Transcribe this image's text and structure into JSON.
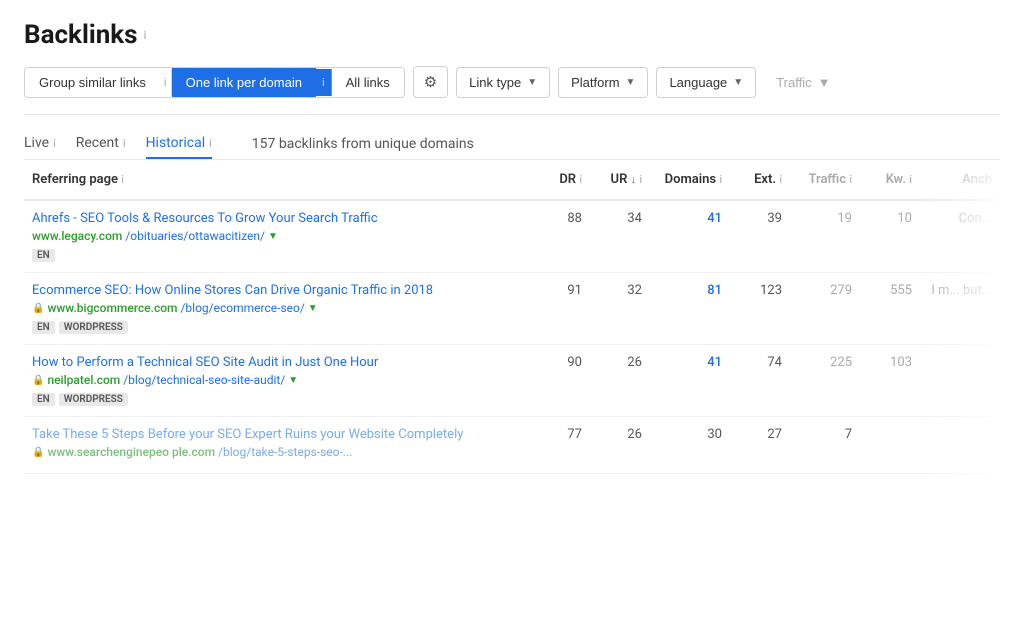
{
  "page": {
    "title": "Backlinks",
    "title_info": "i"
  },
  "toolbar": {
    "group_similar": "Group similar links",
    "group_similar_info": "i",
    "one_per_domain": "One link per domain",
    "one_per_domain_info": "i",
    "all_links": "All links",
    "gear_icon": "⚙",
    "link_type": "Link type",
    "platform": "Platform",
    "language": "Language",
    "traffic": "Traffic"
  },
  "subtabs": {
    "live": "Live",
    "live_info": "i",
    "recent": "Recent",
    "recent_info": "i",
    "historical": "Historical",
    "historical_info": "i",
    "summary": "157 backlinks from unique domains"
  },
  "table": {
    "headers": {
      "referring_page": "Referring page",
      "referring_page_info": "i",
      "dr": "DR",
      "dr_info": "i",
      "ur": "UR",
      "ur_sort": "↓",
      "ur_info": "i",
      "domains": "Domains",
      "domains_info": "i",
      "ext": "Ext.",
      "ext_info": "i",
      "traffic": "Traffic",
      "traffic_info": "i",
      "kw": "Kw.",
      "kw_info": "i",
      "anch": "Anch"
    },
    "rows": [
      {
        "title": "Ahrefs - SEO Tools & Resources To Grow Your Search Traffic",
        "domain": "www.legacy.com",
        "path": "/obituaries/ottawacitizen/",
        "has_dropdown": true,
        "has_lock": false,
        "badges": [
          "EN"
        ],
        "dr": 88,
        "ur": 34,
        "domains": 41,
        "domains_blue": true,
        "ext": 39,
        "traffic": 19,
        "kw": 10,
        "anch": "Con...",
        "faded": false
      },
      {
        "title": "Ecommerce SEO: How Online Stores Can Drive Organic Traffic in 2018",
        "domain": "www.bigcommerce.com",
        "path": "/blog/ecommerce-seo/",
        "has_dropdown": true,
        "has_lock": true,
        "badges": [
          "EN",
          "WORDPRESS"
        ],
        "dr": 91,
        "ur": 32,
        "domains": 81,
        "domains_blue": true,
        "ext": 123,
        "traffic": 279,
        "kw": 555,
        "anch": "I m... but...",
        "faded": false
      },
      {
        "title": "How to Perform a Technical SEO Site Audit in Just One Hour",
        "domain": "neilpatel.com",
        "path": "/blog/technical-seo-site-audit/",
        "has_dropdown": true,
        "has_lock": true,
        "badges": [
          "EN",
          "WORDPRESS"
        ],
        "dr": 90,
        "ur": 26,
        "domains": 41,
        "domains_blue": true,
        "ext": 74,
        "traffic": 225,
        "kw": 103,
        "anch": "",
        "faded": false
      },
      {
        "title": "Take These 5 Steps Before your SEO Expert Ruins your Website Completely",
        "domain": "www.searchenginepeo ple.com",
        "path": "/blog/take-5-steps-seo-...",
        "has_dropdown": false,
        "has_lock": true,
        "badges": [],
        "dr": 77,
        "ur": 26,
        "domains": 30,
        "domains_blue": false,
        "ext": 27,
        "traffic": 7,
        "kw": null,
        "anch": "",
        "faded": true
      }
    ]
  },
  "colors": {
    "accent_blue": "#1e6fe6",
    "green": "#2a9d2a",
    "faded": "#aaa"
  }
}
